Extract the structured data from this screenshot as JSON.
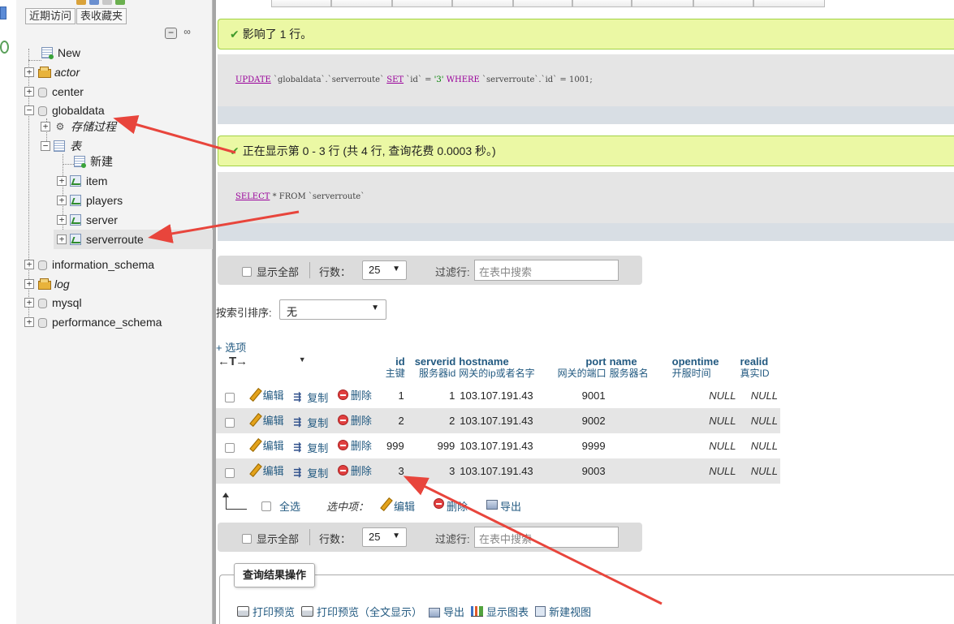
{
  "navigation": {
    "tabs": [
      {
        "label": "近期访问"
      },
      {
        "label": "表收藏夹"
      }
    ],
    "tree": [
      {
        "label": "New"
      },
      {
        "label": "actor"
      },
      {
        "label": "center"
      },
      {
        "label": "globaldata"
      },
      {
        "label": "存储过程"
      },
      {
        "label": "表"
      },
      {
        "label": "新建"
      },
      {
        "label": "item"
      },
      {
        "label": "players"
      },
      {
        "label": "server"
      },
      {
        "label": "serverroute"
      },
      {
        "label": "information_schema"
      },
      {
        "label": "log"
      },
      {
        "label": "mysql"
      },
      {
        "label": "performance_schema"
      }
    ]
  },
  "messages": {
    "update_result": "影响了 1 行。",
    "select_result": "正在显示第 0 - 3 行 (共 4 行, 查询花费 0.0003 秒。)"
  },
  "sql": {
    "update": {
      "kw_update": "UPDATE",
      "table": "`globaldata`.`serverroute`",
      "kw_set": "SET",
      "col": "`id`",
      "eq": "=",
      "value": "'3'",
      "kw_where": "WHERE",
      "cond": "`serverroute`.`id`",
      "cond_value": "1001;"
    },
    "select": {
      "kw_select": "SELECT",
      "rest": "* FROM `serverroute`"
    }
  },
  "nav_bar": {
    "show_all": "显示全部",
    "rows_label": "行数：",
    "rows_value": "25",
    "filter_label": "过滤行:",
    "filter_placeholder": "在表中搜索"
  },
  "sort": {
    "label": "按索引排序:",
    "value": "无"
  },
  "options_link": "+ 选项",
  "table": {
    "head_arrows": "←T→",
    "columns": [
      {
        "name": "id",
        "comment": "主键"
      },
      {
        "name": "serverid",
        "comment": "服务器id"
      },
      {
        "name": "hostname",
        "comment": "网关的ip或者名字"
      },
      {
        "name": "port",
        "comment": "网关的端口"
      },
      {
        "name": "name",
        "comment": "服务器名"
      },
      {
        "name": "opentime",
        "comment": "开服时间"
      },
      {
        "name": "realid",
        "comment": "真实ID"
      }
    ],
    "actions": {
      "edit": "编辑",
      "copy": "复制",
      "delete": "删除"
    },
    "rows": [
      {
        "id": "1",
        "serverid": "1",
        "hostname": "103.107.191.43",
        "port": "9001",
        "name": "",
        "opentime": "NULL",
        "realid": "NULL"
      },
      {
        "id": "2",
        "serverid": "2",
        "hostname": "103.107.191.43",
        "port": "9002",
        "name": "",
        "opentime": "NULL",
        "realid": "NULL"
      },
      {
        "id": "999",
        "serverid": "999",
        "hostname": "103.107.191.43",
        "port": "9999",
        "name": "",
        "opentime": "NULL",
        "realid": "NULL"
      },
      {
        "id": "3",
        "serverid": "3",
        "hostname": "103.107.191.43",
        "port": "9003",
        "name": "",
        "opentime": "NULL",
        "realid": "NULL"
      }
    ]
  },
  "with_selected": {
    "select_all": "全选",
    "label": "选中项：",
    "edit": "编辑",
    "delete": "删除",
    "export": "导出"
  },
  "query_ops": {
    "legend": "查询结果操作",
    "links": [
      "打印预览",
      "打印预览（全文显示）",
      "导出",
      "显示图表",
      "新建视图"
    ]
  },
  "colors": {
    "annotation_arrow": "#e8453c",
    "success_bg": "#ebf8a4",
    "link": "#235a81"
  }
}
